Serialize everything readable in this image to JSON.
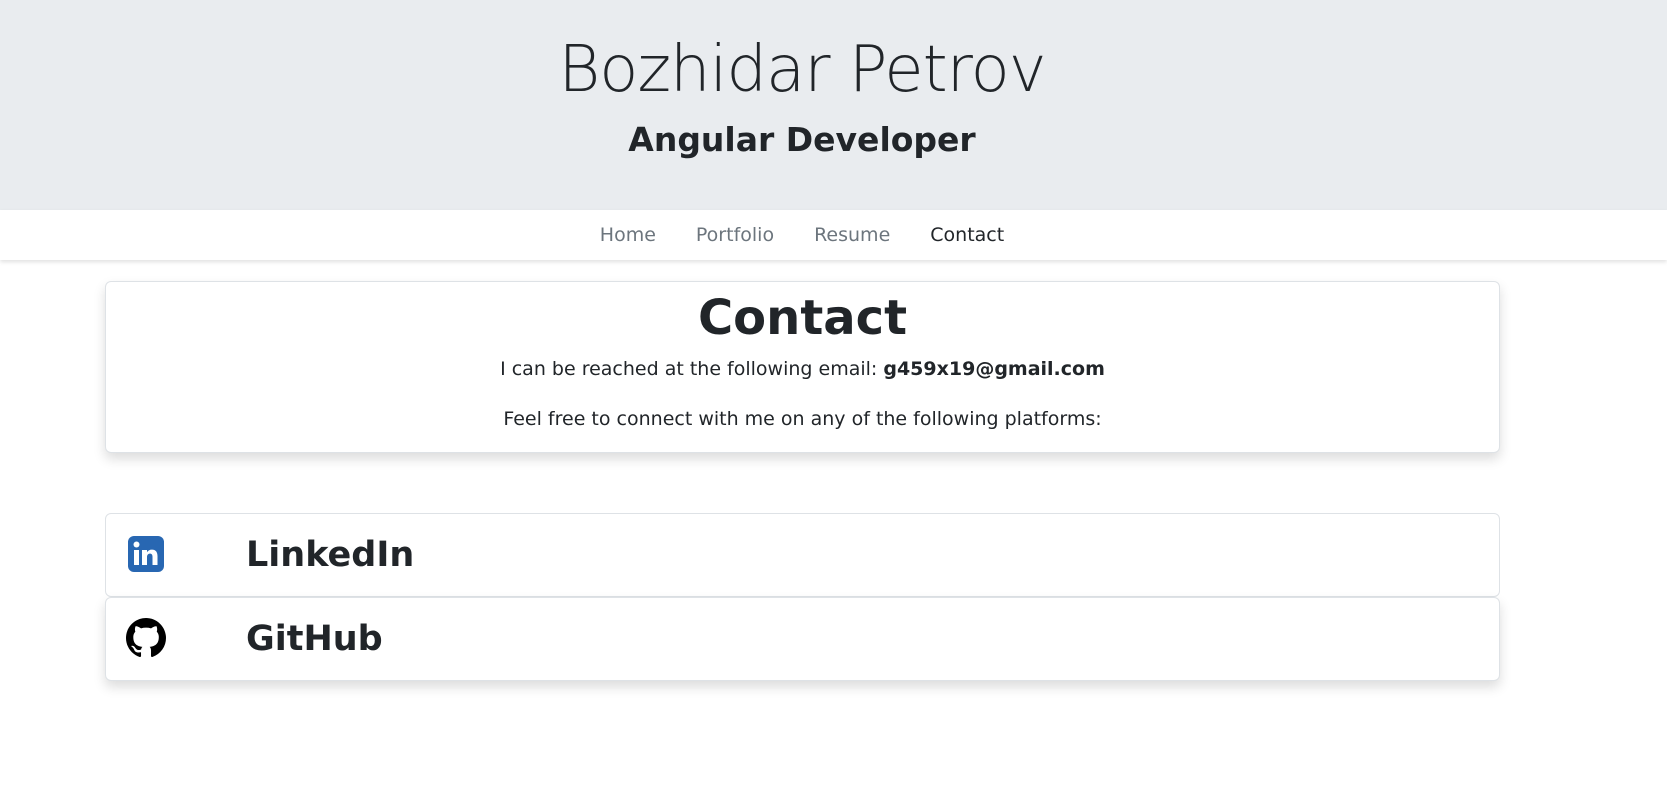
{
  "header": {
    "name": "Bozhidar Petrov",
    "role": "Angular Developer",
    "background": "#e9ecef"
  },
  "nav": {
    "items": [
      {
        "label": "Home"
      },
      {
        "label": "Portfolio"
      },
      {
        "label": "Resume"
      },
      {
        "label": "Contact",
        "active": true
      }
    ]
  },
  "contact": {
    "title": "Contact",
    "email_prefix": "I can be reached at the following email: ",
    "email": "g459x19@gmail.com",
    "platforms_text": "Feel free to connect with me on any of the following platforms:"
  },
  "platforms": [
    {
      "label": "LinkedIn",
      "icon": "linkedin-icon",
      "color": "#2867b2"
    },
    {
      "label": "GitHub",
      "icon": "github-icon",
      "color": "#000000"
    }
  ]
}
